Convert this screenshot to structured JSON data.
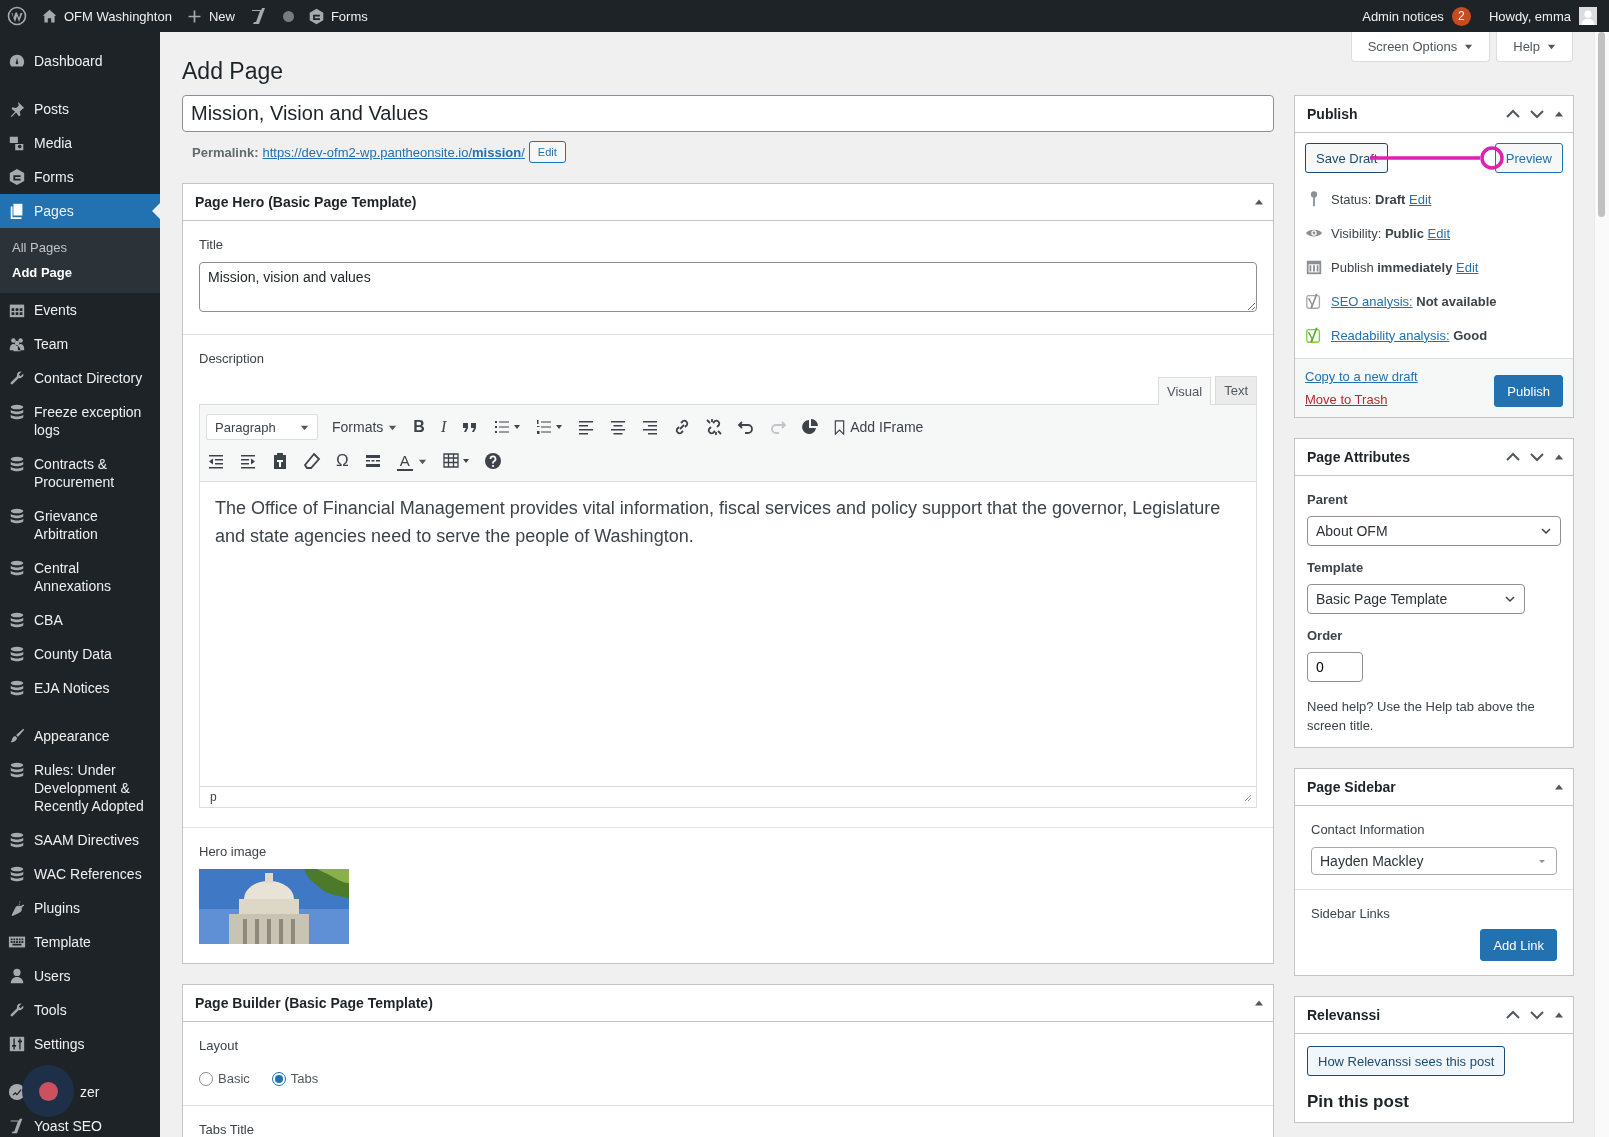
{
  "admin_bar": {
    "site_name": "OFM Washinghton",
    "new_label": "New",
    "forms_label": "Forms",
    "notices_label": "Admin notices",
    "notices_count": "2",
    "greeting": "Howdy, emma"
  },
  "sidebar": {
    "groups": [
      [
        {
          "label": "Dashboard",
          "selected": false
        }
      ],
      [
        {
          "label": "Posts",
          "selected": false
        },
        {
          "label": "Media",
          "selected": false
        },
        {
          "label": "Forms",
          "selected": false
        },
        {
          "label": "Pages",
          "selected": true,
          "children": [
            {
              "label": "All Pages",
              "selected": false
            },
            {
              "label": "Add Page",
              "selected": true
            }
          ]
        },
        {
          "label": "Events",
          "selected": false
        },
        {
          "label": "Team",
          "selected": false
        },
        {
          "label": "Contact Directory",
          "selected": false
        },
        {
          "label": "Freeze exception logs",
          "selected": false
        },
        {
          "label": "Contracts & Procurement",
          "selected": false
        },
        {
          "label": "Grievance Arbitration",
          "selected": false
        },
        {
          "label": "Central Annexations",
          "selected": false
        },
        {
          "label": "CBA",
          "selected": false
        },
        {
          "label": "County Data",
          "selected": false
        },
        {
          "label": "EJA Notices",
          "selected": false
        }
      ],
      [
        {
          "label": "Appearance",
          "selected": false
        },
        {
          "label": "Rules: Under Development & Recently Adopted",
          "selected": false
        },
        {
          "label": "SAAM Directives",
          "selected": false
        },
        {
          "label": "WAC References",
          "selected": false
        },
        {
          "label": "Plugins",
          "selected": false
        },
        {
          "label": "Template",
          "selected": false
        },
        {
          "label": "Users",
          "selected": false
        },
        {
          "label": "Tools",
          "selected": false
        },
        {
          "label": "Settings",
          "selected": false
        }
      ],
      [
        {
          "label": "zer",
          "selected": false
        },
        {
          "label": "Yoast SEO",
          "selected": false
        }
      ]
    ]
  },
  "screen_tabs": [
    "Screen Options",
    "Help"
  ],
  "heading": "Add Page",
  "post_title": "Mission, Vision and Values",
  "permalink": {
    "label": "Permalink:",
    "url": "https://dev-ofm2-wp.pantheonsite.io/**mission**/",
    "button": "Edit"
  },
  "hero_box": {
    "title": "Page Hero (Basic Page Template)",
    "title_label": "Title",
    "title_value": "Mission, vision and values",
    "description_label": "Description",
    "editor_tabs": [
      {
        "label": "Visual",
        "selected": true
      },
      {
        "label": "Text",
        "selected": false
      }
    ],
    "toolbar": {
      "block_format": "Paragraph",
      "formats": "Formats",
      "bold": "B",
      "italic": "I",
      "add_iframe": "Add IFrame",
      "special_character": "Ω",
      "text_color": "A"
    },
    "content": "The Office of Financial Management provides vital information, fiscal services and policy support that the governor, Legislature and state agencies need to serve the people of Washington.",
    "path": "p",
    "hero_image_label": "Hero image"
  },
  "builder_box": {
    "title": "Page Builder (Basic Page Template)",
    "layout_label": "Layout",
    "layouts": [
      {
        "label": "Basic",
        "selected": false
      },
      {
        "label": "Tabs",
        "selected": true
      }
    ],
    "next_label": "Tabs Title"
  },
  "publish": {
    "title": "Publish",
    "save_draft": "Save Draft",
    "preview": "Preview",
    "rows": [
      {
        "label": "Status:",
        "value": "Draft",
        "action": "Edit",
        "label_is_link": false
      },
      {
        "label": "Visibility:",
        "value": "Public",
        "action": "Edit",
        "label_is_link": false
      },
      {
        "label": "Publish",
        "value": "immediately",
        "action": "Edit",
        "label_is_link": false
      },
      {
        "label": "SEO analysis:",
        "value": "Not available",
        "label_is_link": true
      },
      {
        "label": "Readability analysis:",
        "value": "Good",
        "label_is_link": true
      }
    ],
    "copy_link": "Copy to a new draft",
    "trash_link": "Move to Trash",
    "publish_button": "Publish"
  },
  "page_attributes": {
    "title": "Page Attributes",
    "parent_label": "Parent",
    "parent_value": "About OFM",
    "template_label": "Template",
    "template_value": "Basic Page Template",
    "order_label": "Order",
    "order_value": "0",
    "help": "Need help? Use the Help tab above the screen title."
  },
  "page_sidebar": {
    "title": "Page Sidebar",
    "contact_label": "Contact Information",
    "contact_value": "Hayden Mackley",
    "links_label": "Sidebar Links",
    "add_link": "Add Link"
  },
  "relevanssi": {
    "title": "Relevanssi",
    "button": "How Relevanssi sees this post",
    "pin_heading": "Pin this post"
  }
}
